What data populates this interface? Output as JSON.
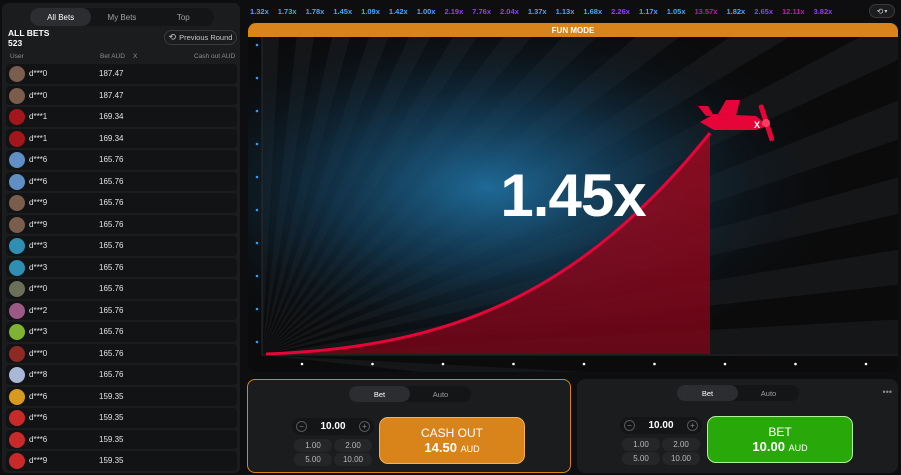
{
  "left": {
    "tabs": [
      "All Bets",
      "My Bets",
      "Top"
    ],
    "title": "ALL BETS",
    "count": "523",
    "previous_round": "Previous Round",
    "columns": {
      "user": "User",
      "bet": "Bet AUD",
      "x": "X",
      "cashout": "Cash out AUD"
    },
    "rows": [
      {
        "user": "d***0",
        "bet": "187.47",
        "avatar_color": "#7a5d4c"
      },
      {
        "user": "d***0",
        "bet": "187.47",
        "avatar_color": "#7a5d4c"
      },
      {
        "user": "d***1",
        "bet": "169.34",
        "avatar_color": "#a3161c"
      },
      {
        "user": "d***1",
        "bet": "169.34",
        "avatar_color": "#a3161c"
      },
      {
        "user": "d***6",
        "bet": "165.76",
        "avatar_color": "#5f8fc4"
      },
      {
        "user": "d***6",
        "bet": "165.76",
        "avatar_color": "#5f8fc4"
      },
      {
        "user": "d***9",
        "bet": "165.76",
        "avatar_color": "#7a5d4c"
      },
      {
        "user": "d***9",
        "bet": "165.76",
        "avatar_color": "#7a5d4c"
      },
      {
        "user": "d***3",
        "bet": "165.76",
        "avatar_color": "#2f8fb2"
      },
      {
        "user": "d***3",
        "bet": "165.76",
        "avatar_color": "#2f8fb2"
      },
      {
        "user": "d***0",
        "bet": "165.76",
        "avatar_color": "#6b6e58"
      },
      {
        "user": "d***2",
        "bet": "165.76",
        "avatar_color": "#9b5a86"
      },
      {
        "user": "d***3",
        "bet": "165.76",
        "avatar_color": "#7fb231"
      },
      {
        "user": "d***0",
        "bet": "165.76",
        "avatar_color": "#8e2a24"
      },
      {
        "user": "d***8",
        "bet": "165.76",
        "avatar_color": "#a8b8d6"
      },
      {
        "user": "d***6",
        "bet": "159.35",
        "avatar_color": "#d89a1e"
      },
      {
        "user": "d***6",
        "bet": "159.35",
        "avatar_color": "#c82a2a"
      },
      {
        "user": "d***6",
        "bet": "159.35",
        "avatar_color": "#c82a2a"
      },
      {
        "user": "d***9",
        "bet": "159.35",
        "avatar_color": "#c82a2a"
      }
    ]
  },
  "history": [
    {
      "v": "1.32x",
      "c": "#4aa3ff"
    },
    {
      "v": "1.73x",
      "c": "#4aa3ff"
    },
    {
      "v": "1.78x",
      "c": "#4aa3ff"
    },
    {
      "v": "1.45x",
      "c": "#4aa3ff"
    },
    {
      "v": "1.09x",
      "c": "#4aa3ff"
    },
    {
      "v": "1.42x",
      "c": "#4aa3ff"
    },
    {
      "v": "1.00x",
      "c": "#4aa3ff"
    },
    {
      "v": "2.19x",
      "c": "#913ef8"
    },
    {
      "v": "7.76x",
      "c": "#913ef8"
    },
    {
      "v": "2.04x",
      "c": "#913ef8"
    },
    {
      "v": "1.37x",
      "c": "#4aa3ff"
    },
    {
      "v": "1.13x",
      "c": "#4aa3ff"
    },
    {
      "v": "1.68x",
      "c": "#4aa3ff"
    },
    {
      "v": "2.26x",
      "c": "#913ef8"
    },
    {
      "v": "1.17x",
      "c": "#4aa3ff"
    },
    {
      "v": "1.05x",
      "c": "#4aa3ff"
    },
    {
      "v": "13.57x",
      "c": "#c017b4"
    },
    {
      "v": "1.82x",
      "c": "#4aa3ff"
    },
    {
      "v": "2.65x",
      "c": "#913ef8"
    },
    {
      "v": "12.11x",
      "c": "#c017b4"
    },
    {
      "v": "3.82x",
      "c": "#913ef8"
    }
  ],
  "game": {
    "mode_banner": "FUN MODE",
    "multiplier": "1.45x",
    "curve_color": "#e50539"
  },
  "panel1": {
    "tabs": [
      "Bet",
      "Auto"
    ],
    "amount": "10.00",
    "quick": [
      "1.00",
      "2.00",
      "5.00",
      "10.00"
    ],
    "action_label": "CASH OUT",
    "action_value": "14.50",
    "currency": "AUD"
  },
  "panel2": {
    "tabs": [
      "Bet",
      "Auto"
    ],
    "amount": "10.00",
    "quick": [
      "1.00",
      "2.00",
      "5.00",
      "10.00"
    ],
    "action_label": "BET",
    "action_value": "10.00",
    "currency": "AUD"
  }
}
